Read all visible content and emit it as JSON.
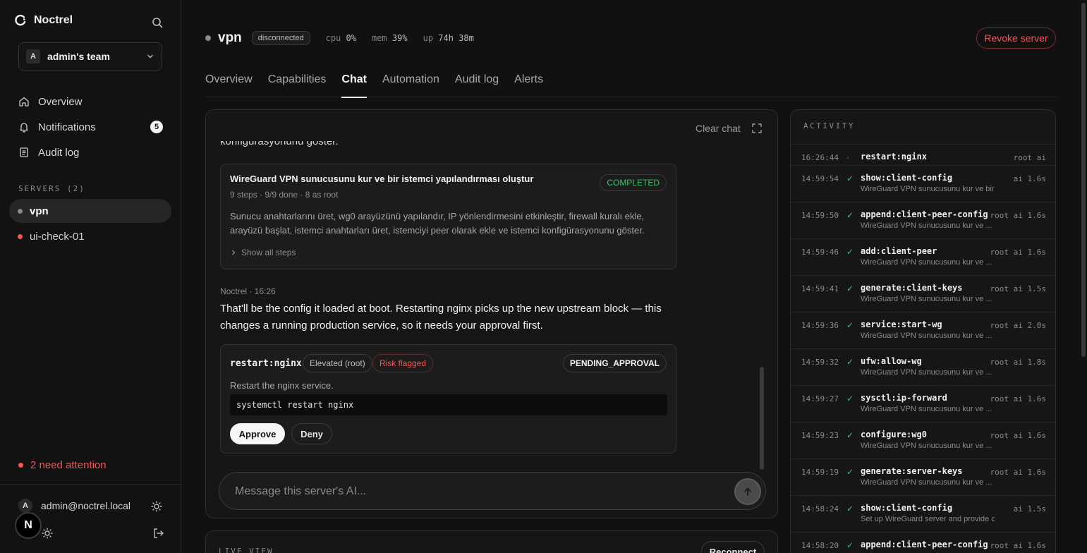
{
  "app": {
    "name": "Noctrel"
  },
  "team": {
    "avatar": "A",
    "name": "admin's team"
  },
  "nav": [
    {
      "label": "Overview",
      "icon": "home-icon"
    },
    {
      "label": "Notifications",
      "icon": "bell-icon",
      "badge": "5"
    },
    {
      "label": "Audit log",
      "icon": "document-icon"
    }
  ],
  "servers": {
    "label": "SERVERS (2)",
    "items": [
      {
        "name": "vpn",
        "status_color": "#8a8a8a",
        "active": true
      },
      {
        "name": "ui-check-01",
        "status_color": "#f25555",
        "active": false
      }
    ]
  },
  "attention": "2 need attention",
  "user": {
    "avatar": "A",
    "email": "admin@noctrel.local",
    "floating_avatar": "N"
  },
  "header": {
    "server_name": "vpn",
    "status": "disconnected",
    "cpu_label": "cpu",
    "cpu": "0%",
    "mem_label": "mem",
    "mem": "39%",
    "up_label": "up",
    "up": "74h 38m",
    "revoke": "Revoke server"
  },
  "tabs": [
    "Overview",
    "Capabilities",
    "Chat",
    "Automation",
    "Audit log",
    "Alerts"
  ],
  "active_tab": "Chat",
  "chat": {
    "clear": "Clear chat",
    "cut_text": "konfigürasyonunu göster.",
    "plan": {
      "title": "WireGuard VPN sunucusunu kur ve bir istemci yapılandırması oluştur",
      "meta": "9 steps · 9/9 done · 8 as root",
      "status": "COMPLETED",
      "description": "Sunucu anahtarlarını üret, wg0 arayüzünü yapılandır, IP yönlendirmesini etkinleştir, firewall kuralı ekle, arayüzü başlat, istemci anahtarları üret, istemciyi peer olarak ekle ve istemci konfigürasyonunu göster.",
      "show_steps": "Show all steps"
    },
    "message": {
      "meta": "Noctrel · 16:26",
      "text": "That'll be the config it loaded at boot. Restarting nginx picks up the new upstream block — this changes a running production service, so it needs your approval first."
    },
    "approval": {
      "command": "restart:nginx",
      "tag_elevated": "Elevated (root)",
      "tag_risk": "Risk flagged",
      "status": "PENDING_APPROVAL",
      "description": "Restart the nginx service.",
      "code": "systemctl restart nginx",
      "approve": "Approve",
      "deny": "Deny"
    },
    "composer_placeholder": "Message this server's AI..."
  },
  "live_view": {
    "label": "LIVE VIEW",
    "reconnect": "Reconnect"
  },
  "activity": {
    "title": "ACTIVITY",
    "items": [
      {
        "time": "16:26:44",
        "mark": "·",
        "cmd": "restart:nginx",
        "desc": "",
        "info": "root ai"
      },
      {
        "time": "14:59:54",
        "mark": "✓",
        "cmd": "show:client-config",
        "desc": "WireGuard VPN sunucusunu kur ve bir ist...",
        "info": "ai 1.6s"
      },
      {
        "time": "14:59:50",
        "mark": "✓",
        "cmd": "append:client-peer-config",
        "desc": "WireGuard VPN sunucusunu kur ve ...",
        "info": "root ai 1.6s"
      },
      {
        "time": "14:59:46",
        "mark": "✓",
        "cmd": "add:client-peer",
        "desc": "WireGuard VPN sunucusunu kur ve ...",
        "info": "root ai 1.6s"
      },
      {
        "time": "14:59:41",
        "mark": "✓",
        "cmd": "generate:client-keys",
        "desc": "WireGuard VPN sunucusunu kur ve ...",
        "info": "root ai 1.5s"
      },
      {
        "time": "14:59:36",
        "mark": "✓",
        "cmd": "service:start-wg",
        "desc": "WireGuard VPN sunucusunu kur ve ...",
        "info": "root ai 2.0s"
      },
      {
        "time": "14:59:32",
        "mark": "✓",
        "cmd": "ufw:allow-wg",
        "desc": "WireGuard VPN sunucusunu kur ve ...",
        "info": "root ai 1.8s"
      },
      {
        "time": "14:59:27",
        "mark": "✓",
        "cmd": "sysctl:ip-forward",
        "desc": "WireGuard VPN sunucusunu kur ve ...",
        "info": "root ai 1.6s"
      },
      {
        "time": "14:59:23",
        "mark": "✓",
        "cmd": "configure:wg0",
        "desc": "WireGuard VPN sunucusunu kur ve ...",
        "info": "root ai 1.6s"
      },
      {
        "time": "14:59:19",
        "mark": "✓",
        "cmd": "generate:server-keys",
        "desc": "WireGuard VPN sunucusunu kur ve ...",
        "info": "root ai 1.6s"
      },
      {
        "time": "14:58:24",
        "mark": "✓",
        "cmd": "show:client-config",
        "desc": "Set up WireGuard server and provide clie...",
        "info": "ai 1.5s"
      },
      {
        "time": "14:58:20",
        "mark": "✓",
        "cmd": "append:client-peer-config",
        "desc": "",
        "info": "root ai 1.6s"
      }
    ]
  }
}
